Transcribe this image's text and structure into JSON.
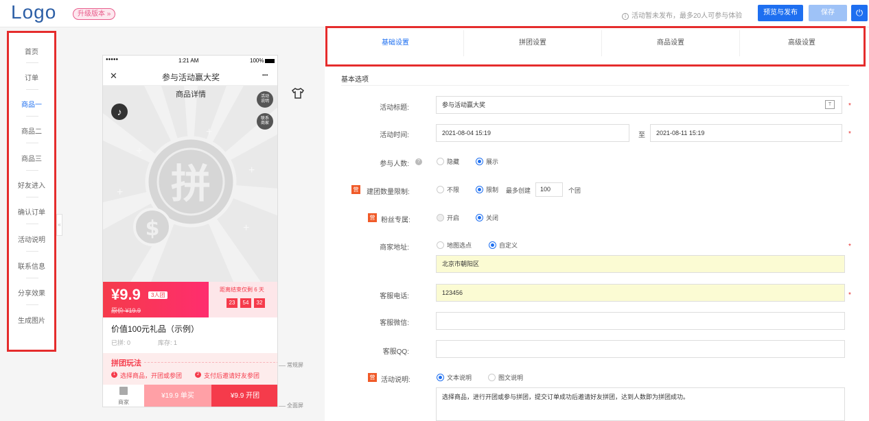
{
  "header": {
    "logo": "Logo",
    "upgrade": "升级版本 »",
    "notice": "活动暂未发布，最多20人可参与体验",
    "publish": "预览与发布",
    "save": "保存",
    "power_icon": "⏻"
  },
  "sidebar": {
    "items": [
      "首页",
      "订单",
      "商品一",
      "商品二",
      "商品三",
      "好友进入",
      "确认订单",
      "活动说明",
      "联系信息",
      "分享效果",
      "生成图片"
    ],
    "active": "商品一"
  },
  "phone": {
    "status": {
      "carrier": "●●●●●",
      "time": "1:21 AM",
      "battery": "100%"
    },
    "nav": {
      "close": "✕",
      "title": "参与活动赢大奖",
      "more": "•••"
    },
    "page_tab": "商品详情",
    "rule_btn": "活动\n说明",
    "contact_btn": "联系\n商家",
    "hero_char": "拼",
    "price": "¥9.9",
    "group_tag": "3人团",
    "orig_price": "原价 ¥19.9",
    "countdown_label": "距离结束仅剩 6 天",
    "countdown": [
      "23",
      "54",
      "32"
    ],
    "product_name": "价值100元礼品（示例）",
    "joined": "已拼: 0",
    "stock": "库存: 1",
    "play_title": "拼团玩法",
    "step1": "选择商品，开团或参团",
    "step2": "支付后邀请好友参团",
    "shop": "商家",
    "buy_single": "¥19.9 单买",
    "buy_group": "¥9.9 开团"
  },
  "screen_marks": {
    "normal": "常规屏",
    "full": "全面屏"
  },
  "tabs": [
    "基础设置",
    "拼团设置",
    "商品设置",
    "高级设置"
  ],
  "active_tab": "基础设置",
  "form": {
    "section": "基本选项",
    "title_label": "活动标题:",
    "title_value": "参与活动赢大奖",
    "time_label": "活动时间:",
    "time_start": "2021-08-04 15:19",
    "time_to": "至",
    "time_end": "2021-08-11 15:19",
    "count_label": "参与人数:",
    "count_hide": "隐藏",
    "count_show": "展示",
    "group_limit_label": "建团数量限制:",
    "limit_none": "不限",
    "limit_on": "限制",
    "limit_prefix": "最多创建",
    "limit_value": "100",
    "limit_suffix": "个团",
    "fans_label": "粉丝专属:",
    "fans_on": "开启",
    "fans_off": "关闭",
    "addr_label": "商家地址:",
    "addr_map": "地图选点",
    "addr_custom": "自定义",
    "addr_value": "北京市朝阳区",
    "phone_label": "客服电话:",
    "phone_value": "123456",
    "wechat_label": "客服微信:",
    "qq_label": "客服QQ:",
    "desc_label": "活动说明:",
    "desc_text_opt": "文本说明",
    "desc_img_opt": "图文说明",
    "desc_value": "选择商品，进行开团或参与拼团，提交订单成功后邀请好友拼团，达到人数即为拼团成功。",
    "badge": "营"
  },
  "colors": {
    "accent": "#1e6ff0",
    "highlight": "#e52c2c",
    "price": "#f53b4b"
  }
}
